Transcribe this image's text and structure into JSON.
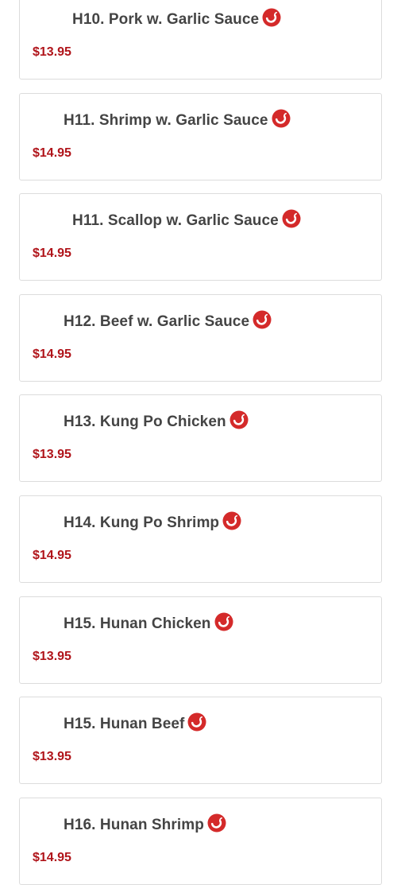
{
  "menu": {
    "items": [
      {
        "name": "H10. Pork w. Garlic Sauce",
        "price": "$13.95",
        "spicy_icon": "chili-pepper-icon"
      },
      {
        "name": "H11. Shrimp w. Garlic Sauce",
        "price": "$14.95",
        "spicy_icon": "chili-pepper-icon"
      },
      {
        "name": "H11. Scallop w. Garlic Sauce",
        "price": "$14.95",
        "spicy_icon": "chili-pepper-icon"
      },
      {
        "name": "H12. Beef w. Garlic Sauce",
        "price": "$14.95",
        "spicy_icon": "chili-pepper-icon"
      },
      {
        "name": "H13. Kung Po Chicken",
        "price": "$13.95",
        "spicy_icon": "chili-pepper-icon"
      },
      {
        "name": "H14. Kung Po Shrimp",
        "price": "$14.95",
        "spicy_icon": "chili-pepper-icon"
      },
      {
        "name": "H15. Hunan Chicken",
        "price": "$13.95",
        "spicy_icon": "chili-pepper-icon"
      },
      {
        "name": "H15. Hunan Beef",
        "price": "$13.95",
        "spicy_icon": "chili-pepper-icon"
      },
      {
        "name": "H16. Hunan Shrimp",
        "price": "$14.95",
        "spicy_icon": "chili-pepper-icon"
      }
    ]
  },
  "colors": {
    "price": "#b0141a",
    "spicy_icon": "#d42a2a",
    "item_name": "#444444",
    "card_border": "#dcdcdc"
  }
}
